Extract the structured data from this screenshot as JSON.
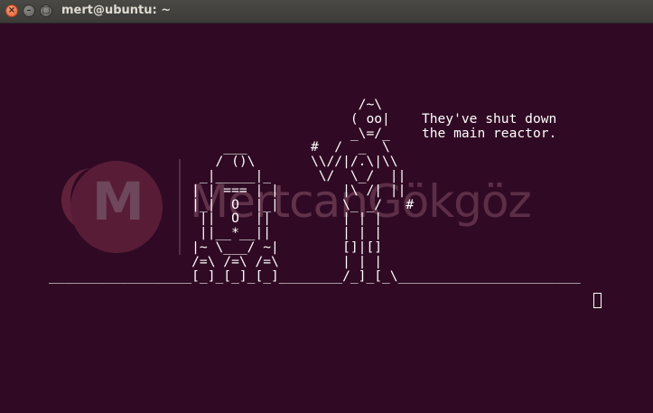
{
  "window": {
    "title": "mert@ubuntu: ~",
    "buttons": {
      "close_icon": "close-icon",
      "minimize_icon": "minimize-icon",
      "maximize_icon": "maximize-icon"
    }
  },
  "terminal": {
    "background": "#300a24",
    "foreground": "#ffffff",
    "lines": [
      "                                       /~\\",
      "                                      ( oo|    They've shut down",
      "                                      _\\=/_    the main reactor.",
      "                      ___        #  /  _  \\",
      "                     / ()\\       \\\\//|/.\\|\\\\",
      "                   _|_____|_      \\/  \\_/  ||",
      "                  | | === | |        |\\ /| ||",
      "                  |_|  O  |_|        \\_ _/   #",
      "                   ||  O  ||         | | |",
      "                   ||__*__||         | | |",
      "                  |~ \\___/ ~|        []|[]",
      "                  /=\\ /=\\ /=\\        | | |",
      "__________________[_]_[_]_[_]________/_]_[_\\_______________________"
    ]
  },
  "watermark": {
    "first_name": "Mertcan",
    "last_name": "Gökgöz",
    "logo_letter": "M",
    "color": "#b0445d"
  }
}
